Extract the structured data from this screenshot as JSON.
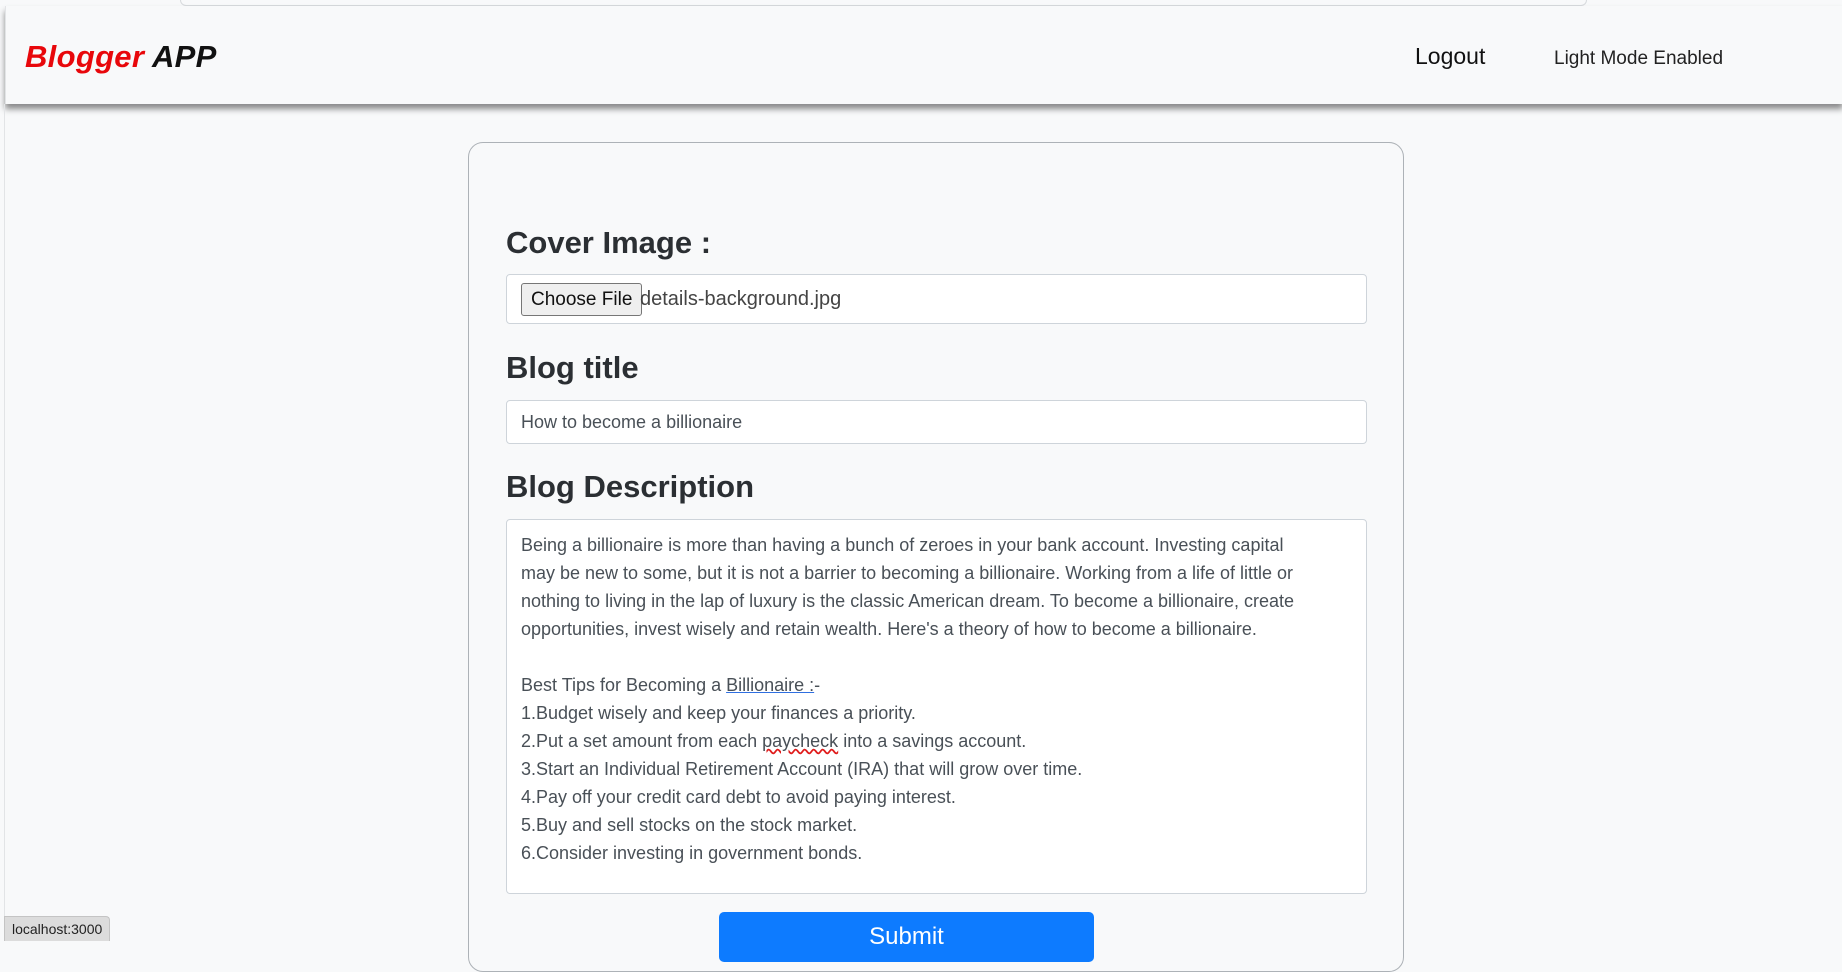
{
  "navbar": {
    "brand_part1": "Blogger",
    "brand_part2": " APP",
    "logout_label": "Logout",
    "mode_label": "Light Mode Enabled"
  },
  "form": {
    "cover_image_label": "Cover Image :",
    "choose_file_label": "Choose File",
    "selected_file": "details-background.jpg",
    "blog_title_label": "Blog title",
    "blog_title_value": "How to become a billionaire",
    "blog_description_label": "Blog Description",
    "description": {
      "intro_line1": "Being a billionaire is more than having a bunch of zeroes in your bank account. Investing capital",
      "intro_line2": "may be new to some, but it is not a barrier to becoming a billionaire. Working from a life of little or",
      "intro_line3": "nothing to living in the lap of luxury is the classic American dream. To become a billionaire, create",
      "intro_line4": "opportunities, invest wisely and retain wealth. Here's a theory of how to become a billionaire.",
      "tips_heading_prefix": "Best Tips for Becoming a ",
      "tips_heading_word": "Billionaire :",
      "tips_heading_suffix": "-",
      "tip1": "1.Budget wisely and keep your finances a priority.",
      "tip2_prefix": "2.Put a set amount from each ",
      "tip2_word": "paycheck",
      "tip2_suffix": " into a savings account.",
      "tip3": "3.Start an Individual Retirement Account (IRA) that will grow over time.",
      "tip4": "4.Pay off your credit card debt to avoid paying interest.",
      "tip5": "5.Buy and sell stocks on the stock market.",
      "tip6": "6.Consider investing in government bonds."
    },
    "submit_label": "Submit"
  },
  "status_bar": {
    "url": "localhost:3000"
  },
  "colors": {
    "brand_red": "#e8070b",
    "submit_blue": "#0d7bff",
    "background": "#f8f9fa"
  }
}
